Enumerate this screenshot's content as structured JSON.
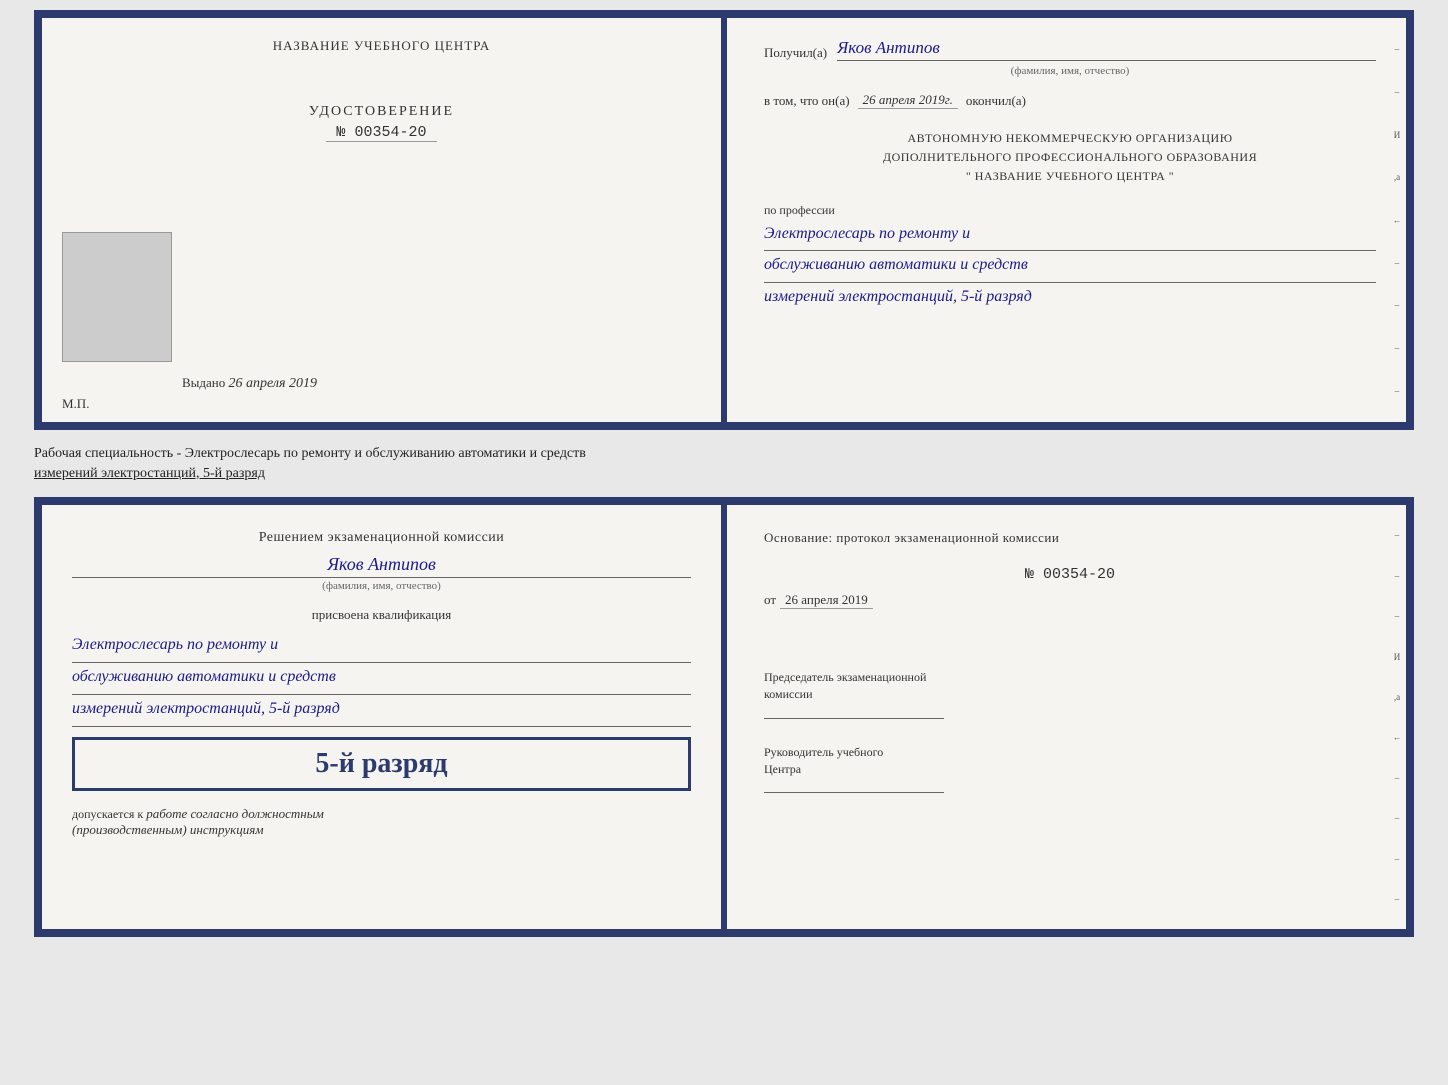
{
  "top_cert": {
    "left": {
      "center_title": "НАЗВАНИЕ УЧЕБНОГО ЦЕНТРА",
      "udost_label": "УДОСТОВЕРЕНИЕ",
      "udost_number": "№ 00354-20",
      "issued_prefix": "Выдано",
      "issued_date": "26 апреля 2019",
      "mp_label": "М.П."
    },
    "right": {
      "recipient_prefix": "Получил(а)",
      "recipient_name": "Яков Антипов",
      "fio_subtitle": "(фамилия, имя, отчество)",
      "date_prefix": "в том, что он(а)",
      "date_value": "26 апреля 2019г.",
      "date_suffix": "окончил(а)",
      "org_line1": "АВТОНОМНУЮ НЕКОММЕРЧЕСКУЮ ОРГАНИЗАЦИЮ",
      "org_line2": "ДОПОЛНИТЕЛЬНОГО ПРОФЕССИОНАЛЬНОГО ОБРАЗОВАНИЯ",
      "org_line3": "\"    НАЗВАНИЕ УЧЕБНОГО ЦЕНТРА    \"",
      "profession_prefix": "по профессии",
      "profession_line1": "Электрослесарь по ремонту и",
      "profession_line2": "обслуживанию автоматики и средств",
      "profession_line3": "измерений электростанций, 5-й разряд"
    }
  },
  "separator": {
    "text_line1": "Рабочая специальность - Электрослесарь по ремонту и обслуживанию автоматики и средств",
    "text_line2": "измерений электростанций, 5-й разряд"
  },
  "bottom_cert": {
    "left": {
      "decision_title": "Решением экзаменационной комиссии",
      "decision_name": "Яков Антипов",
      "fio_subtitle": "(фамилия, имя, отчество)",
      "assigned_label": "присвоена квалификация",
      "qual_line1": "Электрослесарь по ремонту и",
      "qual_line2": "обслуживанию автоматики и средств",
      "qual_line3": "измерений электростанций, 5-й разряд",
      "rank_badge": "5-й разряд",
      "allowed_prefix": "допускается к",
      "allowed_text": "работе согласно должностным",
      "allowed_text2": "(производственным) инструкциям"
    },
    "right": {
      "basis_title": "Основание: протокол экзаменационной комиссии",
      "basis_number": "№  00354-20",
      "basis_date_prefix": "от",
      "basis_date": "26 апреля 2019",
      "chairman_role1": "Председатель экзаменационной",
      "chairman_role2": "комиссии",
      "director_role1": "Руководитель учебного",
      "director_role2": "Центра"
    }
  }
}
